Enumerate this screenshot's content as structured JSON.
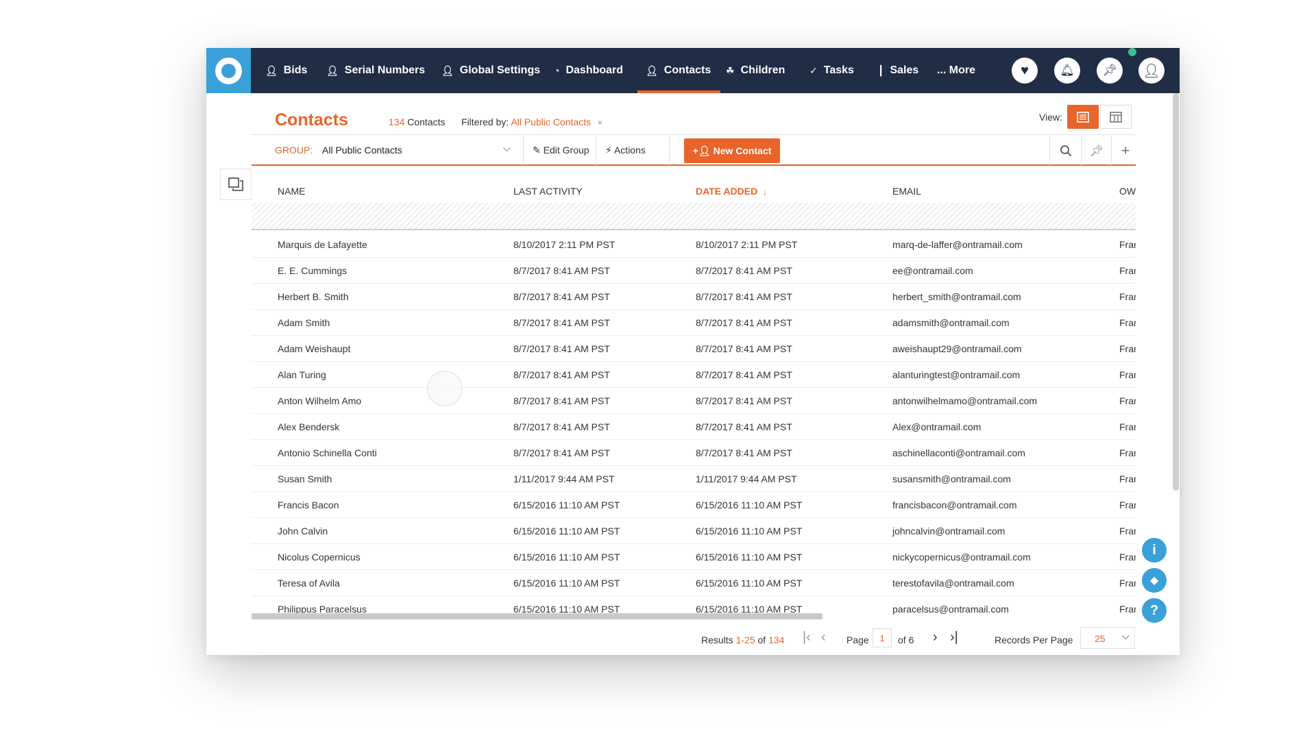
{
  "nav": {
    "items": [
      {
        "label": "Bids",
        "icon": "person-icon"
      },
      {
        "label": "Serial Numbers",
        "icon": "person-icon"
      },
      {
        "label": "Global Settings",
        "icon": "person-icon"
      },
      {
        "label": "Dashboard",
        "icon": "dashboard-icon"
      },
      {
        "label": "Contacts",
        "icon": "person-icon",
        "active": true
      },
      {
        "label": "Children",
        "icon": "stroller-icon"
      },
      {
        "label": "Tasks",
        "icon": "check-icon"
      },
      {
        "label": "Sales",
        "icon": "bar-chart-icon"
      },
      {
        "label": "... More",
        "icon": ""
      }
    ],
    "accent": "#e8642b",
    "background": "#1f2d45",
    "logo_color": "#3aa0d8"
  },
  "header": {
    "title": "Contacts",
    "count": "134",
    "count_label": "Contacts",
    "filter_label": "Filtered by:",
    "filter_value": "All Public Contacts",
    "filter_clear": "×",
    "view_label": "View:"
  },
  "toolbar": {
    "group_label": "GROUP:",
    "group_value": "All Public Contacts",
    "edit_group": "Edit Group",
    "actions": "Actions",
    "new_contact": "New Contact"
  },
  "table": {
    "columns": [
      "NAME",
      "LAST ACTIVITY",
      "DATE ADDED",
      "EMAIL",
      "OWI"
    ],
    "sort_indicator": "↓",
    "rows": [
      [
        "Marquis de Lafayette",
        "8/10/2017 2:11 PM PST",
        "8/10/2017 2:11 PM PST",
        "marq-de-laffer@ontramail.com",
        "Frar"
      ],
      [
        "E. E. Cummings",
        "8/7/2017 8:41 AM PST",
        "8/7/2017 8:41 AM PST",
        "ee@ontramail.com",
        "Frar"
      ],
      [
        "Herbert B. Smith",
        "8/7/2017 8:41 AM PST",
        "8/7/2017 8:41 AM PST",
        "herbert_smith@ontramail.com",
        "Frar"
      ],
      [
        "Adam Smith",
        "8/7/2017 8:41 AM PST",
        "8/7/2017 8:41 AM PST",
        "adamsmith@ontramail.com",
        "Frar"
      ],
      [
        "Adam Weishaupt",
        "8/7/2017 8:41 AM PST",
        "8/7/2017 8:41 AM PST",
        "aweishaupt29@ontramail.com",
        "Frar"
      ],
      [
        "Alan Turing",
        "8/7/2017 8:41 AM PST",
        "8/7/2017 8:41 AM PST",
        "alanturingtest@ontramail.com",
        "Frar"
      ],
      [
        "Anton Wilhelm Amo",
        "8/7/2017 8:41 AM PST",
        "8/7/2017 8:41 AM PST",
        "antonwilhelmamo@ontramail.com",
        "Frar"
      ],
      [
        "Alex Bendersk",
        "8/7/2017 8:41 AM PST",
        "8/7/2017 8:41 AM PST",
        "Alex@ontramail.com",
        "Frar"
      ],
      [
        "Antonio Schinella Conti",
        "8/7/2017 8:41 AM PST",
        "8/7/2017 8:41 AM PST",
        "aschinellaconti@ontramail.com",
        "Frar"
      ],
      [
        "Susan Smith",
        "1/11/2017 9:44 AM PST",
        "1/11/2017 9:44 AM PST",
        "susansmith@ontramail.com",
        "Frar"
      ],
      [
        "Francis Bacon",
        "6/15/2016 11:10 AM PST",
        "6/15/2016 11:10 AM PST",
        "francisbacon@ontramail.com",
        "Frar"
      ],
      [
        "John Calvin",
        "6/15/2016 11:10 AM PST",
        "6/15/2016 11:10 AM PST",
        "johncalvin@ontramail.com",
        "Frar"
      ],
      [
        "Nicolus Copernicus",
        "6/15/2016 11:10 AM PST",
        "6/15/2016 11:10 AM PST",
        "nickycopernicus@ontramail.com",
        "Frar"
      ],
      [
        "Teresa of Avila",
        "6/15/2016 11:10 AM PST",
        "6/15/2016 11:10 AM PST",
        "terestofavila@ontramail.com",
        "Frar"
      ],
      [
        "Philippus Paracelsus",
        "6/15/2016 11:10 AM PST",
        "6/15/2016 11:10 AM PST",
        "paracelsus@ontramail.com",
        "Frar"
      ]
    ]
  },
  "pagination": {
    "results_label": "Results",
    "range": "1-25",
    "of_label": "of",
    "total": "134",
    "page_label": "Page",
    "page": "1",
    "page_of": "of 6",
    "records_label": "Records Per Page",
    "per_page": "25"
  },
  "float_buttons": [
    "info-icon",
    "graduation-cap-icon",
    "help-icon"
  ]
}
